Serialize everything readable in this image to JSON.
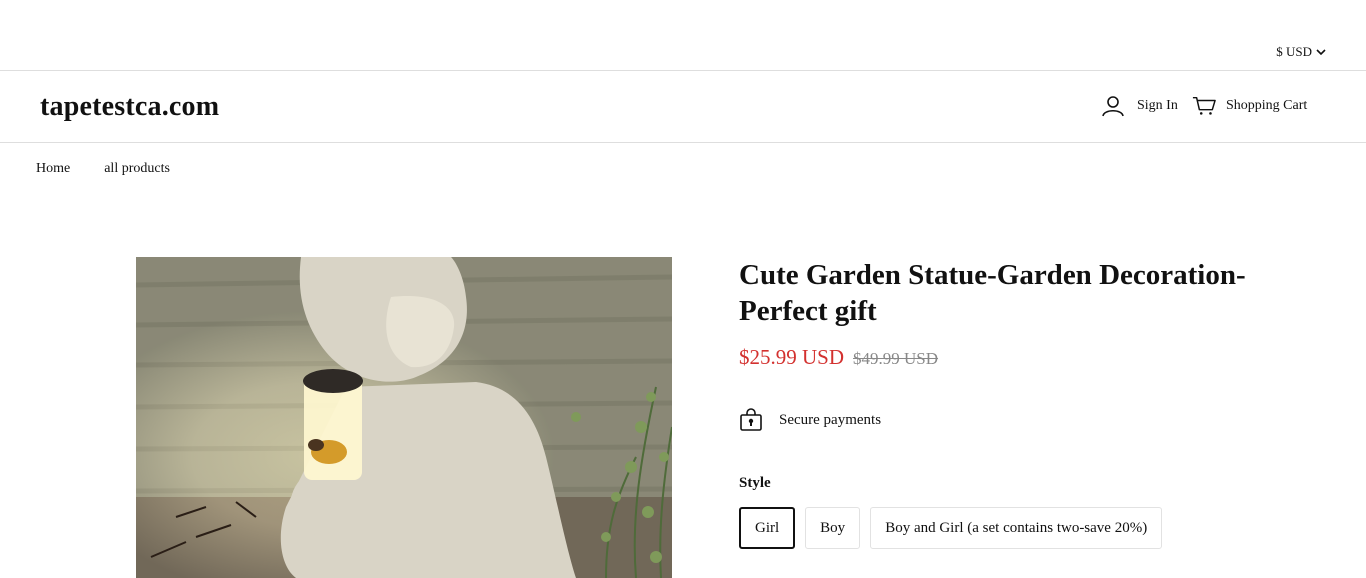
{
  "topbar": {
    "currency_label": "$ USD"
  },
  "header": {
    "logo": "tapetestca.com",
    "sign_in": "Sign In",
    "cart": "Shopping Cart"
  },
  "breadcrumb": [
    "Home",
    "all products"
  ],
  "product": {
    "title": "Cute Garden Statue-Garden Decoration-Perfect gift",
    "price": "$25.99 USD",
    "compare_price": "$49.99 USD",
    "secure_label": "Secure payments",
    "style_label": "Style",
    "options": [
      {
        "label": "Girl",
        "selected": true
      },
      {
        "label": "Boy",
        "selected": false
      },
      {
        "label": "Boy and Girl (a set contains two-save 20%)",
        "selected": false
      }
    ]
  },
  "colors": {
    "sale_price": "#d3312f",
    "border": "#dedede"
  }
}
